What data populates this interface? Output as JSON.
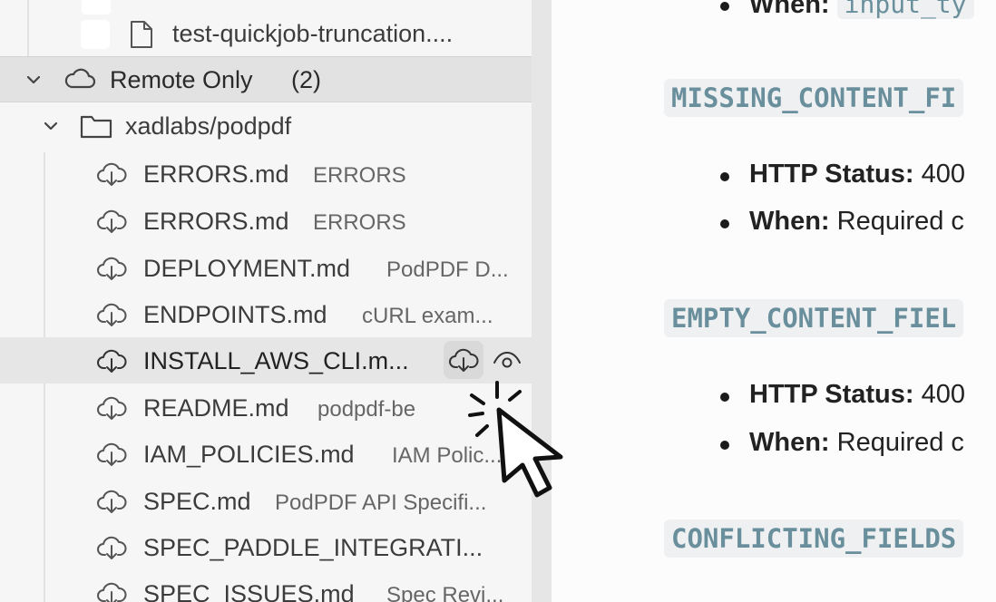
{
  "sidebar": {
    "top_file": {
      "name": "test-quickjob-truncation...."
    },
    "group": {
      "label": "Remote Only",
      "count": "(2)"
    },
    "repo": {
      "name": "xadlabs/podpdf"
    },
    "files": [
      {
        "name": "ERRORS.md",
        "desc": "ERRORS"
      },
      {
        "name": "ERRORS.md",
        "desc": "ERRORS"
      },
      {
        "name": "DEPLOYMENT.md",
        "desc": "PodPDF D..."
      },
      {
        "name": "ENDPOINTS.md",
        "desc": "cURL exam..."
      },
      {
        "name": "INSTALL_AWS_CLI.m...",
        "desc": ""
      },
      {
        "name": "README.md",
        "desc": "podpdf-be"
      },
      {
        "name": "IAM_POLICIES.md",
        "desc": "IAM Polic..."
      },
      {
        "name": "SPEC.md",
        "desc": "PodPDF API Specifi..."
      },
      {
        "name": "SPEC_PADDLE_INTEGRATI...",
        "desc": ""
      },
      {
        "name": "SPEC_ISSUES.md",
        "desc": "Spec Revi..."
      }
    ],
    "icons": {
      "download": "cloud-download-icon",
      "preview": "eye-icon"
    }
  },
  "main": {
    "top_bullet": {
      "label": "When:",
      "code": "input_ty"
    },
    "sections": [
      {
        "heading": "MISSING_CONTENT_FI",
        "items": [
          {
            "label": "HTTP Status:",
            "text": "400"
          },
          {
            "label": "When:",
            "text": "Required c"
          }
        ]
      },
      {
        "heading": "EMPTY_CONTENT_FIEL",
        "items": [
          {
            "label": "HTTP Status:",
            "text": "400"
          },
          {
            "label": "When:",
            "text": "Required c"
          }
        ]
      },
      {
        "heading": "CONFLICTING_FIELDS",
        "items": []
      }
    ]
  },
  "colors": {
    "accent_code": "#6a8f9c",
    "sidebar_bg": "#f6f6f6",
    "selected_row": "#e6e6e6"
  }
}
